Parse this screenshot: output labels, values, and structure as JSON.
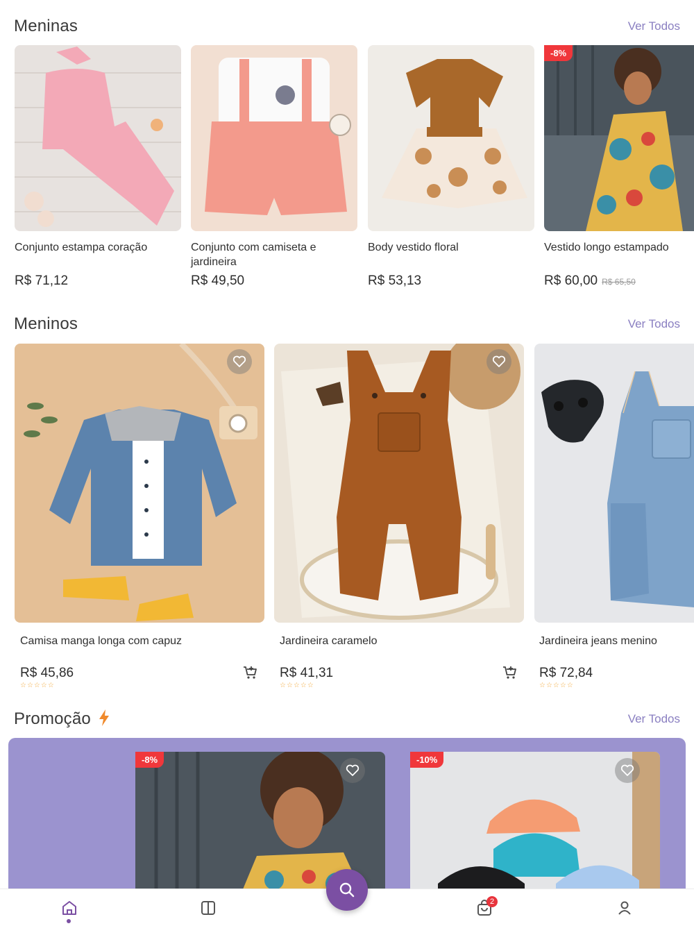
{
  "sections": {
    "girls": {
      "title": "Meninas",
      "see_all": "Ver Todos"
    },
    "boys": {
      "title": "Meninos",
      "see_all": "Ver Todos"
    },
    "promo": {
      "title": "Promoção",
      "see_all": "Ver Todos"
    }
  },
  "girls_products": [
    {
      "name": "Conjunto estampa coração",
      "price": "R$ 71,12"
    },
    {
      "name": "Conjunto com camiseta e jardineira",
      "price": "R$ 49,50"
    },
    {
      "name": "Body vestido floral",
      "price": "R$ 53,13"
    },
    {
      "name": "Vestido longo estampado",
      "price": "R$ 60,00",
      "old_price": "R$ 65,50",
      "discount": "-8%"
    }
  ],
  "boys_products": [
    {
      "name": "Camisa manga longa com capuz",
      "price": "R$ 45,86",
      "stars": "☆☆☆☆☆"
    },
    {
      "name": "Jardineira caramelo",
      "price": "R$ 41,31",
      "stars": "☆☆☆☆☆"
    },
    {
      "name": "Jardineira jeans menino",
      "price": "R$ 72,84",
      "stars": "☆☆☆☆☆"
    }
  ],
  "promo_products": [
    {
      "discount": "-8%"
    },
    {
      "discount": "-10%"
    }
  ],
  "nav": {
    "items": [
      "home-icon",
      "catalog-icon",
      "search-icon",
      "bag-icon",
      "profile-icon"
    ],
    "cart_count": "2"
  },
  "colors": {
    "accent": "#7b4fa3",
    "link": "#8a7fc1",
    "promo_band": "#9b93cf",
    "discount_badge": "#f0373b",
    "lightning": "#f08a2c"
  }
}
